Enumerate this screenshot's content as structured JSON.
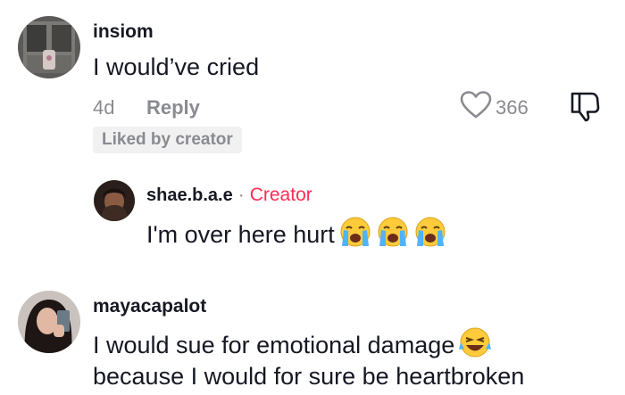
{
  "comments": [
    {
      "username": "insiom",
      "text": "I would’ve cried",
      "time": "4d",
      "reply_label": "Reply",
      "like_count": "366",
      "badge": "Liked by creator"
    }
  ],
  "reply": {
    "username": "shae.b.a.e",
    "separator": "·",
    "creator_label": "Creator",
    "text": "I'm over here hurt"
  },
  "comment2": {
    "username": "mayacapalot",
    "line1": "I would sue for emotional damage",
    "line2": "because I would for sure be heartbroken"
  },
  "colors": {
    "accent": "#fe2c55",
    "muted": "#8a8b91",
    "text": "#161823"
  },
  "icons": [
    "heart-icon",
    "dislike-icon",
    "crying-emoji-icon",
    "laughing-emoji-icon"
  ]
}
